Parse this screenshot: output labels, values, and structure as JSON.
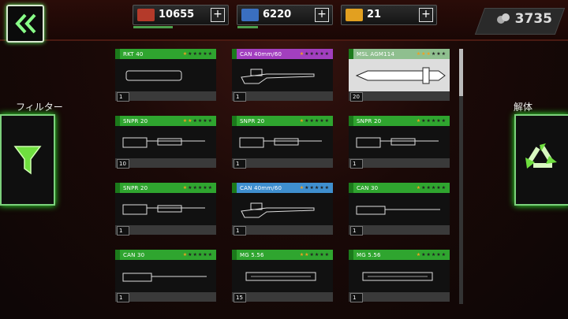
{
  "resources": [
    {
      "value": "10655",
      "icon": "red-crate-icon",
      "color": "#b43a2a"
    },
    {
      "value": "6220",
      "icon": "blue-crate-icon",
      "color": "#3a6fc0"
    },
    {
      "value": "21",
      "icon": "gold-bars-icon",
      "color": "#e2a020"
    }
  ],
  "coins": "3735",
  "filter_label": "フィルター",
  "dismantle_label": "解体",
  "items": [
    {
      "name": "RKT 40",
      "stars": 1,
      "qty": "1",
      "style": "green",
      "icon": "rocket-pod-icon"
    },
    {
      "name": "CAN 40mm/60",
      "stars": 1,
      "qty": "1",
      "style": "purple",
      "icon": "cannon-icon"
    },
    {
      "name": "MSL AGM114",
      "stars": 3,
      "qty": "20",
      "style": "sel",
      "icon": "missile-icon"
    },
    {
      "name": "SNPR 20",
      "stars": 2,
      "qty": "10",
      "style": "green",
      "icon": "sniper-gun-icon"
    },
    {
      "name": "SNPR 20",
      "stars": 1,
      "qty": "1",
      "style": "green",
      "icon": "sniper-gun-icon"
    },
    {
      "name": "SNPR 20",
      "stars": 1,
      "qty": "1",
      "style": "green",
      "icon": "sniper-gun-icon"
    },
    {
      "name": "SNPR 20",
      "stars": 1,
      "qty": "1",
      "style": "green",
      "icon": "sniper-gun-icon"
    },
    {
      "name": "CAN 40mm/60",
      "stars": 1,
      "qty": "1",
      "style": "blue",
      "icon": "cannon-icon"
    },
    {
      "name": "CAN 30",
      "stars": 1,
      "qty": "1",
      "style": "green",
      "icon": "autocannon-icon"
    },
    {
      "name": "CAN 30",
      "stars": 1,
      "qty": "1",
      "style": "green",
      "icon": "autocannon-icon"
    },
    {
      "name": "MG 5.56",
      "stars": 2,
      "qty": "15",
      "style": "green",
      "icon": "machine-gun-icon"
    },
    {
      "name": "MG 5.56",
      "stars": 1,
      "qty": "1",
      "style": "green",
      "icon": "machine-gun-icon"
    }
  ]
}
